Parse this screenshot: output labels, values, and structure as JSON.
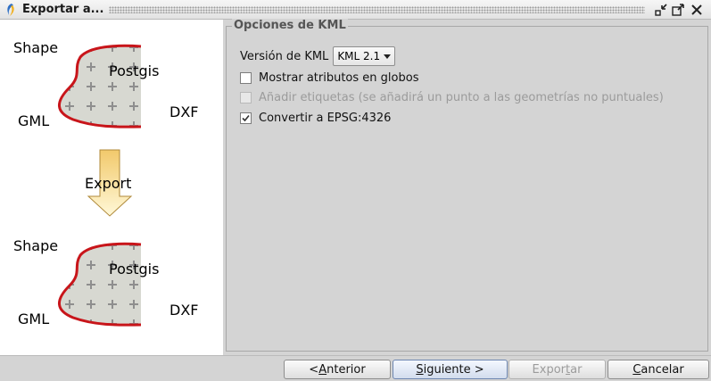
{
  "window": {
    "title": "Exportar a...",
    "icon": "gvsig-app-icon"
  },
  "illustration": {
    "top": {
      "shape_label": "Shape",
      "postgis_label": "Postgis",
      "gml_label": "GML",
      "dxf_label": "DXF"
    },
    "arrow_label": "Export",
    "bottom": {
      "shape_label": "Shape",
      "postgis_label": "Postgis",
      "gml_label": "GML",
      "dxf_label": "DXF"
    },
    "colors": {
      "outline": "#c8151a",
      "fill": "#d7d8d1",
      "cross": "#8e8e8e",
      "arrow_fill_top": "#f2c96b",
      "arrow_fill_bottom": "#fff8d8"
    }
  },
  "kml_options": {
    "legend": "Opciones de KML",
    "version_label": "Versión de KML",
    "version_value": "KML 2.1",
    "show_attributes": {
      "label": "Mostrar atributos en globos",
      "checked": false,
      "enabled": true
    },
    "add_labels": {
      "label": "Añadir etiquetas (se añadirá un punto a las geometrías no puntuales)",
      "checked": false,
      "enabled": false
    },
    "convert_epsg": {
      "label": "Convertir a EPSG:4326",
      "checked": true,
      "enabled": true
    }
  },
  "buttons": {
    "previous": {
      "prefix": "< ",
      "mnemonic": "A",
      "rest": "nterior"
    },
    "next": {
      "mnemonic": "S",
      "rest": "iguiente >"
    },
    "export": {
      "prefix": "Expor",
      "mnemonic": "t",
      "rest": "ar"
    },
    "cancel": {
      "mnemonic": "C",
      "rest": "ancelar"
    }
  }
}
